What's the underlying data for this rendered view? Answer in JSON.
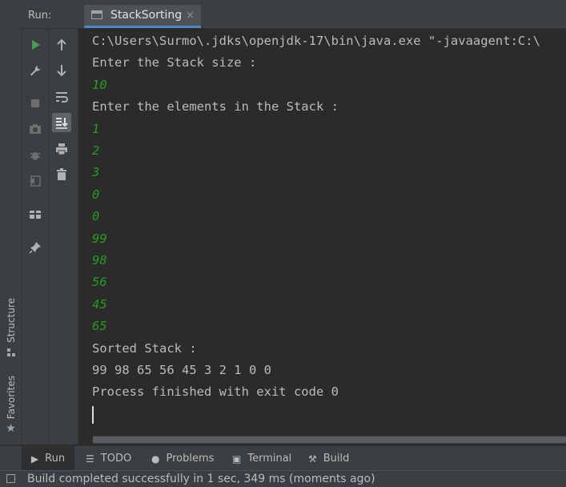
{
  "header": {
    "run_label": "Run:",
    "run_tab": "StackSorting",
    "close_glyph": "×"
  },
  "left_bar": {
    "structure_label": "Structure",
    "favorites_label": "Favorites"
  },
  "toolbar": {
    "col1": [
      "rerun-icon",
      "wrench-icon",
      "stop-icon",
      "camera-icon",
      "debug-bug-icon",
      "exit-icon",
      "layout-icon",
      "pin-icon"
    ],
    "col2": [
      "up-arrow-icon",
      "down-arrow-icon",
      "soft-wrap-icon",
      "scroll-to-end-icon",
      "print-icon",
      "trash-icon"
    ]
  },
  "console": {
    "lines": [
      {
        "text": "C:\\Users\\Surmo\\.jdks\\openjdk-17\\bin\\java.exe \"-javaagent:C:\\",
        "kind": "output"
      },
      {
        "text": "Enter the Stack size :",
        "kind": "output"
      },
      {
        "text": "10",
        "kind": "input"
      },
      {
        "text": "Enter the elements in the Stack :",
        "kind": "output"
      },
      {
        "text": "1",
        "kind": "input"
      },
      {
        "text": "2",
        "kind": "input"
      },
      {
        "text": "3",
        "kind": "input"
      },
      {
        "text": "0",
        "kind": "input"
      },
      {
        "text": "0",
        "kind": "input"
      },
      {
        "text": "99",
        "kind": "input"
      },
      {
        "text": "98",
        "kind": "input"
      },
      {
        "text": "56",
        "kind": "input"
      },
      {
        "text": "45",
        "kind": "input"
      },
      {
        "text": "65",
        "kind": "input"
      },
      {
        "text": "Sorted Stack :",
        "kind": "output"
      },
      {
        "text": "99 98 65 56 45 3 2 1 0 0",
        "kind": "output"
      },
      {
        "text": "Process finished with exit code 0",
        "kind": "output"
      }
    ]
  },
  "bottom_tabs": [
    {
      "label": "Run",
      "icon": "play-icon",
      "active": true
    },
    {
      "label": "TODO",
      "icon": "list-icon",
      "active": false
    },
    {
      "label": "Problems",
      "icon": "problems-icon",
      "active": false
    },
    {
      "label": "Terminal",
      "icon": "terminal-icon",
      "active": false
    },
    {
      "label": "Build",
      "icon": "hammer-icon",
      "active": false
    }
  ],
  "status": {
    "text": "Build completed successfully in 1 sec, 349 ms (moments ago)"
  },
  "colors": {
    "input_text": "#289b1d",
    "output_text": "#bbbbbb",
    "accent": "#4a88c7",
    "run_green": "#499c54"
  }
}
